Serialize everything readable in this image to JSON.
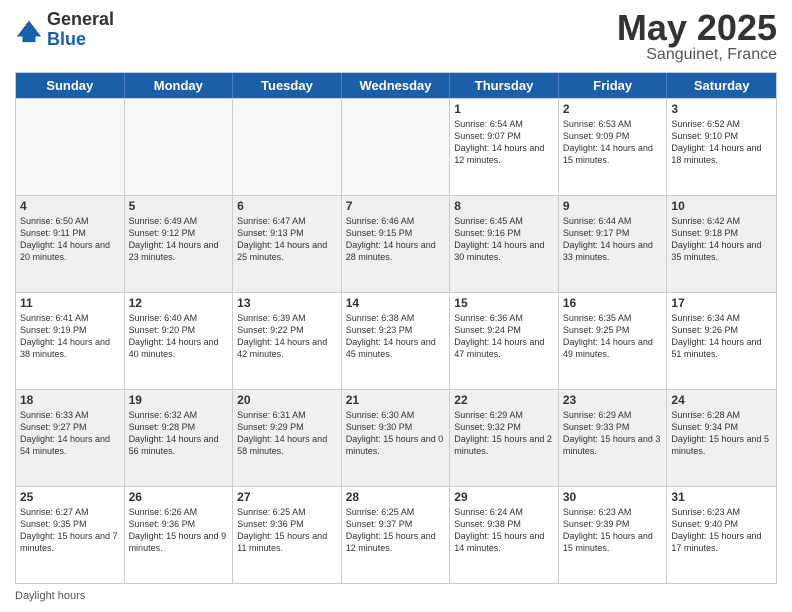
{
  "header": {
    "logo_general": "General",
    "logo_blue": "Blue",
    "title_month": "May 2025",
    "title_location": "Sanguinet, France"
  },
  "calendar": {
    "days": [
      "Sunday",
      "Monday",
      "Tuesday",
      "Wednesday",
      "Thursday",
      "Friday",
      "Saturday"
    ],
    "weeks": [
      [
        {
          "num": "",
          "content": "",
          "empty": true
        },
        {
          "num": "",
          "content": "",
          "empty": true
        },
        {
          "num": "",
          "content": "",
          "empty": true
        },
        {
          "num": "",
          "content": "",
          "empty": true
        },
        {
          "num": "1",
          "content": "Sunrise: 6:54 AM\nSunset: 9:07 PM\nDaylight: 14 hours\nand 12 minutes.",
          "empty": false
        },
        {
          "num": "2",
          "content": "Sunrise: 6:53 AM\nSunset: 9:09 PM\nDaylight: 14 hours\nand 15 minutes.",
          "empty": false
        },
        {
          "num": "3",
          "content": "Sunrise: 6:52 AM\nSunset: 9:10 PM\nDaylight: 14 hours\nand 18 minutes.",
          "empty": false
        }
      ],
      [
        {
          "num": "4",
          "content": "Sunrise: 6:50 AM\nSunset: 9:11 PM\nDaylight: 14 hours\nand 20 minutes.",
          "empty": false
        },
        {
          "num": "5",
          "content": "Sunrise: 6:49 AM\nSunset: 9:12 PM\nDaylight: 14 hours\nand 23 minutes.",
          "empty": false
        },
        {
          "num": "6",
          "content": "Sunrise: 6:47 AM\nSunset: 9:13 PM\nDaylight: 14 hours\nand 25 minutes.",
          "empty": false
        },
        {
          "num": "7",
          "content": "Sunrise: 6:46 AM\nSunset: 9:15 PM\nDaylight: 14 hours\nand 28 minutes.",
          "empty": false
        },
        {
          "num": "8",
          "content": "Sunrise: 6:45 AM\nSunset: 9:16 PM\nDaylight: 14 hours\nand 30 minutes.",
          "empty": false
        },
        {
          "num": "9",
          "content": "Sunrise: 6:44 AM\nSunset: 9:17 PM\nDaylight: 14 hours\nand 33 minutes.",
          "empty": false
        },
        {
          "num": "10",
          "content": "Sunrise: 6:42 AM\nSunset: 9:18 PM\nDaylight: 14 hours\nand 35 minutes.",
          "empty": false
        }
      ],
      [
        {
          "num": "11",
          "content": "Sunrise: 6:41 AM\nSunset: 9:19 PM\nDaylight: 14 hours\nand 38 minutes.",
          "empty": false
        },
        {
          "num": "12",
          "content": "Sunrise: 6:40 AM\nSunset: 9:20 PM\nDaylight: 14 hours\nand 40 minutes.",
          "empty": false
        },
        {
          "num": "13",
          "content": "Sunrise: 6:39 AM\nSunset: 9:22 PM\nDaylight: 14 hours\nand 42 minutes.",
          "empty": false
        },
        {
          "num": "14",
          "content": "Sunrise: 6:38 AM\nSunset: 9:23 PM\nDaylight: 14 hours\nand 45 minutes.",
          "empty": false
        },
        {
          "num": "15",
          "content": "Sunrise: 6:36 AM\nSunset: 9:24 PM\nDaylight: 14 hours\nand 47 minutes.",
          "empty": false
        },
        {
          "num": "16",
          "content": "Sunrise: 6:35 AM\nSunset: 9:25 PM\nDaylight: 14 hours\nand 49 minutes.",
          "empty": false
        },
        {
          "num": "17",
          "content": "Sunrise: 6:34 AM\nSunset: 9:26 PM\nDaylight: 14 hours\nand 51 minutes.",
          "empty": false
        }
      ],
      [
        {
          "num": "18",
          "content": "Sunrise: 6:33 AM\nSunset: 9:27 PM\nDaylight: 14 hours\nand 54 minutes.",
          "empty": false
        },
        {
          "num": "19",
          "content": "Sunrise: 6:32 AM\nSunset: 9:28 PM\nDaylight: 14 hours\nand 56 minutes.",
          "empty": false
        },
        {
          "num": "20",
          "content": "Sunrise: 6:31 AM\nSunset: 9:29 PM\nDaylight: 14 hours\nand 58 minutes.",
          "empty": false
        },
        {
          "num": "21",
          "content": "Sunrise: 6:30 AM\nSunset: 9:30 PM\nDaylight: 15 hours\nand 0 minutes.",
          "empty": false
        },
        {
          "num": "22",
          "content": "Sunrise: 6:29 AM\nSunset: 9:32 PM\nDaylight: 15 hours\nand 2 minutes.",
          "empty": false
        },
        {
          "num": "23",
          "content": "Sunrise: 6:29 AM\nSunset: 9:33 PM\nDaylight: 15 hours\nand 3 minutes.",
          "empty": false
        },
        {
          "num": "24",
          "content": "Sunrise: 6:28 AM\nSunset: 9:34 PM\nDaylight: 15 hours\nand 5 minutes.",
          "empty": false
        }
      ],
      [
        {
          "num": "25",
          "content": "Sunrise: 6:27 AM\nSunset: 9:35 PM\nDaylight: 15 hours\nand 7 minutes.",
          "empty": false
        },
        {
          "num": "26",
          "content": "Sunrise: 6:26 AM\nSunset: 9:36 PM\nDaylight: 15 hours\nand 9 minutes.",
          "empty": false
        },
        {
          "num": "27",
          "content": "Sunrise: 6:25 AM\nSunset: 9:36 PM\nDaylight: 15 hours\nand 11 minutes.",
          "empty": false
        },
        {
          "num": "28",
          "content": "Sunrise: 6:25 AM\nSunset: 9:37 PM\nDaylight: 15 hours\nand 12 minutes.",
          "empty": false
        },
        {
          "num": "29",
          "content": "Sunrise: 6:24 AM\nSunset: 9:38 PM\nDaylight: 15 hours\nand 14 minutes.",
          "empty": false
        },
        {
          "num": "30",
          "content": "Sunrise: 6:23 AM\nSunset: 9:39 PM\nDaylight: 15 hours\nand 15 minutes.",
          "empty": false
        },
        {
          "num": "31",
          "content": "Sunrise: 6:23 AM\nSunset: 9:40 PM\nDaylight: 15 hours\nand 17 minutes.",
          "empty": false
        }
      ]
    ]
  },
  "footer": {
    "text": "Daylight hours"
  }
}
